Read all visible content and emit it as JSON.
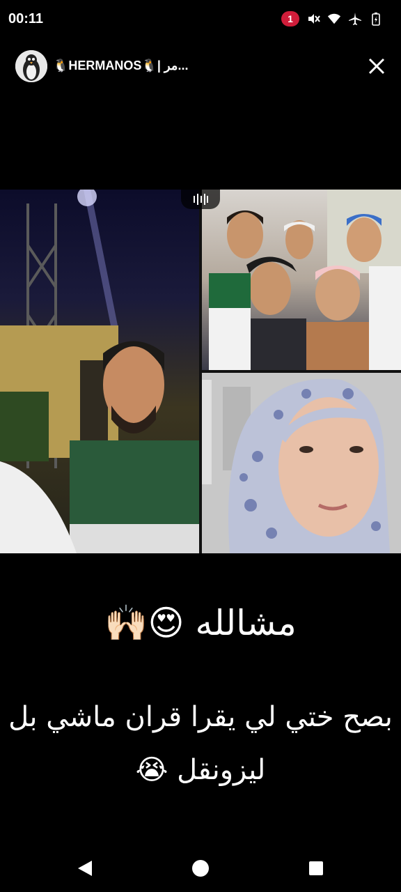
{
  "status_bar": {
    "time": "00:11",
    "notification_count": "1",
    "icons": [
      "mute-icon",
      "wifi-icon",
      "airplane-icon",
      "battery-icon"
    ]
  },
  "header": {
    "channel_name": "🐧HERMANOS🐧| مر...",
    "avatar_icon": "penguin-avatar"
  },
  "video_grid": {
    "tiles": [
      "left-participant-video",
      "group-participants-video",
      "hijab-participant-video"
    ]
  },
  "caption": {
    "line1": "مشالله 😍🙌🏻",
    "line2": "بصح ختي لي يقرا قران ماشي بل",
    "line3": "ليزونقل 😭"
  },
  "nav_bar": {
    "buttons": [
      "back-icon",
      "home-icon",
      "recents-icon"
    ]
  },
  "colors": {
    "background": "#000000",
    "badge": "#d01d3a",
    "text": "#ffffff"
  }
}
